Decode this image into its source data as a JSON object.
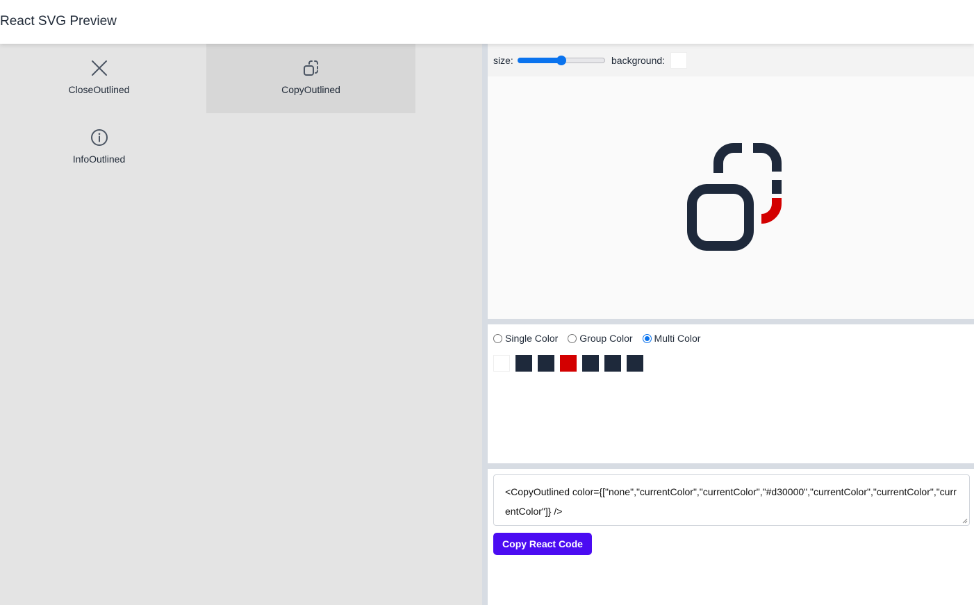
{
  "app": {
    "title": "React SVG Preview"
  },
  "icons": [
    {
      "label": "CloseOutlined",
      "icon": "close-icon",
      "selected": false
    },
    {
      "label": "CopyOutlined",
      "icon": "copy-icon",
      "selected": true
    },
    {
      "label": "InfoOutlined",
      "icon": "info-icon",
      "selected": false
    }
  ],
  "toolbar": {
    "size_label": "size:",
    "size_slider_fraction": 0.5,
    "background_label": "background:",
    "background_color": "#ffffff"
  },
  "preview": {
    "icon": "copy-icon",
    "icon_color": "#1e293b",
    "accent_color": "#d30000"
  },
  "color_mode": {
    "options": [
      "Single Color",
      "Group Color",
      "Multi Color"
    ],
    "selected": "Multi Color"
  },
  "swatches": [
    "#ffffff",
    "#1e293b",
    "#1e293b",
    "#d30000",
    "#1e293b",
    "#1e293b",
    "#1e293b"
  ],
  "code": {
    "text": "<CopyOutlined color={[\"none\",\"currentColor\",\"currentColor\",\"#d30000\",\"currentColor\",\"currentColor\",\"currentColor\"]} />",
    "button_label": "Copy React Code"
  },
  "colors": {
    "accent_button": "#4b0cf2",
    "radio_accent": "#0a73ee"
  }
}
